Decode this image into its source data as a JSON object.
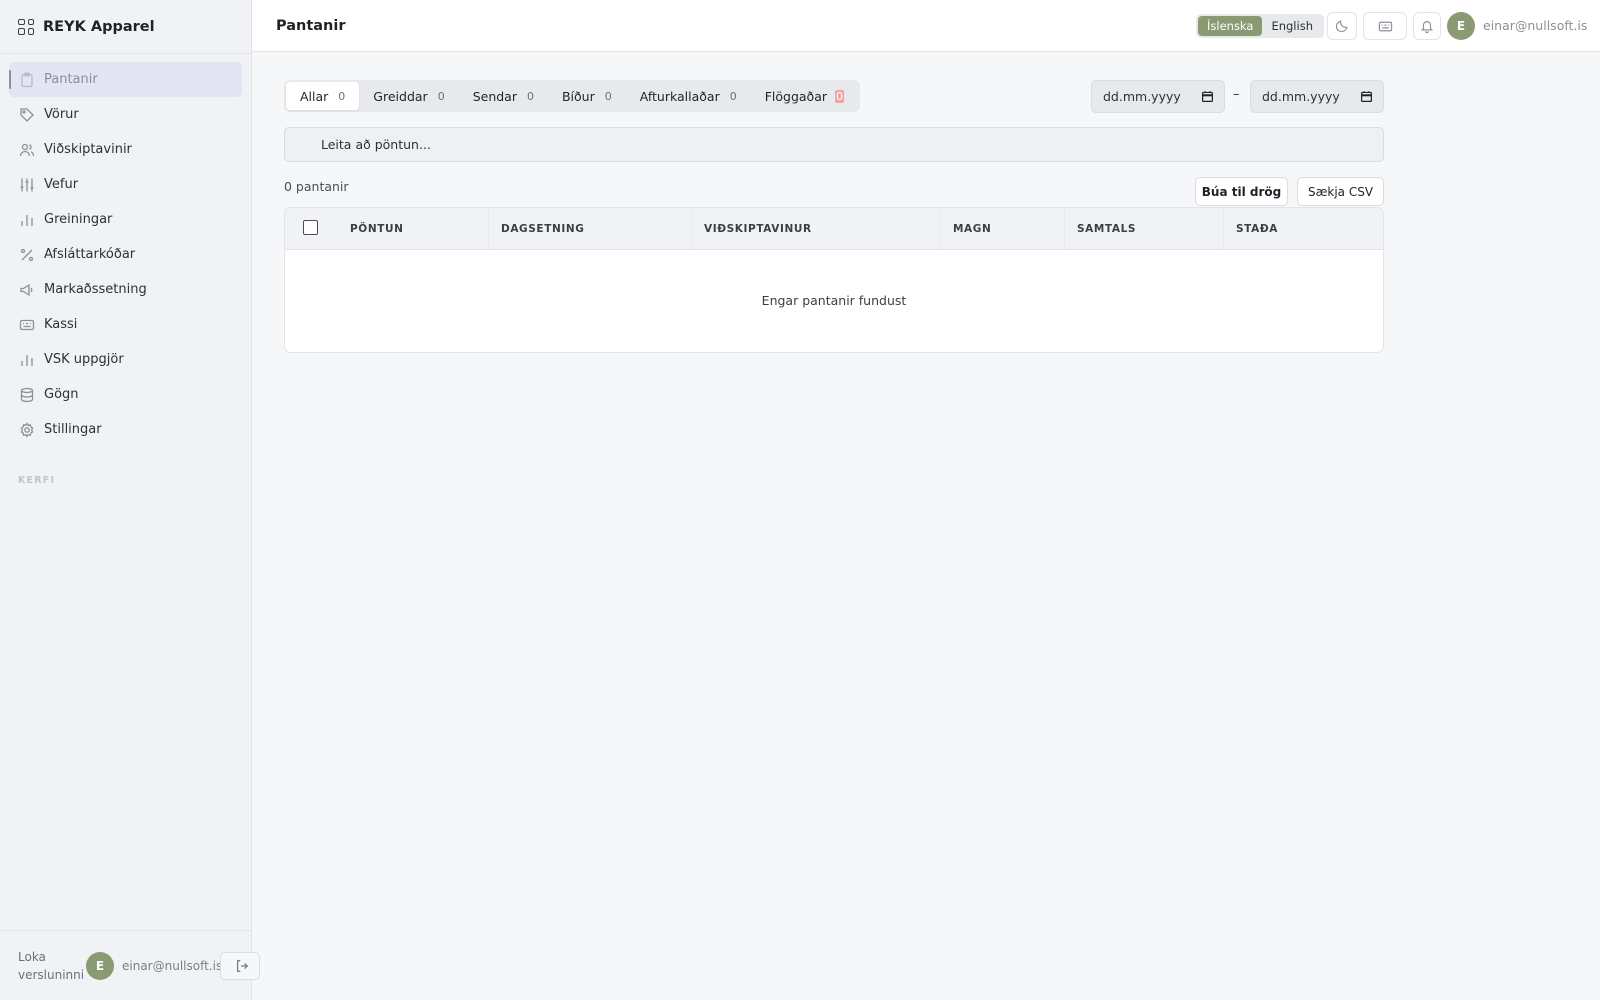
{
  "brand": {
    "title": "REYK Apparel"
  },
  "sidebar": {
    "items": [
      {
        "label": "Pantanir",
        "icon": "clipboard-icon",
        "active": true
      },
      {
        "label": "Vörur",
        "icon": "tag-icon"
      },
      {
        "label": "Viðskiptavinir",
        "icon": "users-icon"
      },
      {
        "label": "Vefur",
        "icon": "sliders-icon"
      },
      {
        "label": "Greiningar",
        "icon": "bar-chart-icon"
      },
      {
        "label": "Afsláttarkóðar",
        "icon": "percent-icon"
      },
      {
        "label": "Markaðssetning",
        "icon": "megaphone-icon"
      },
      {
        "label": "Kassi",
        "icon": "keyboard-icon"
      },
      {
        "label": "VSK uppgjör",
        "icon": "bar-chart-icon"
      },
      {
        "label": "Gögn",
        "icon": "database-icon"
      },
      {
        "label": "Stillingar",
        "icon": "gear-icon"
      }
    ],
    "section_label": "KERFI",
    "footer": {
      "close_store": "Loka versluninni",
      "avatar_initial": "E",
      "email": "einar@nullsoft.is"
    }
  },
  "header": {
    "title": "Pantanir",
    "languages": [
      "Íslenska",
      "English"
    ],
    "active_language": "Íslenska",
    "avatar_initial": "E",
    "email": "einar@nullsoft.is"
  },
  "main": {
    "tabs": [
      {
        "label": "Allar",
        "count": "0",
        "active": true
      },
      {
        "label": "Greiddar",
        "count": "0"
      },
      {
        "label": "Sendar",
        "count": "0"
      },
      {
        "label": "Bíður",
        "count": "0"
      },
      {
        "label": "Afturkallaðar",
        "count": "0"
      },
      {
        "label": "Flöggaðar",
        "count": "0",
        "alert": true
      }
    ],
    "date_from_placeholder": "dd.mm.yyyy",
    "date_to_placeholder": "dd.mm.yyyy",
    "date_separator": "–",
    "search_placeholder": "Leita að pöntun...",
    "order_count": "0 pantanir",
    "create_draft_label": "Búa til drög",
    "download_csv_label": "Sækja CSV",
    "table": {
      "columns": [
        "PÖNTUN",
        "DAGSETNING",
        "VIÐSKIPTAVINUR",
        "MAGN",
        "SAMTALS",
        "STAÐA"
      ],
      "empty_message": "Engar pantanir fundust"
    }
  },
  "colors": {
    "accent": "#8a9a72",
    "sidebar_bg": "#f1f2f5",
    "active_item_bg": "#e3e4f4",
    "flag_badge": "#f0a3a3"
  }
}
